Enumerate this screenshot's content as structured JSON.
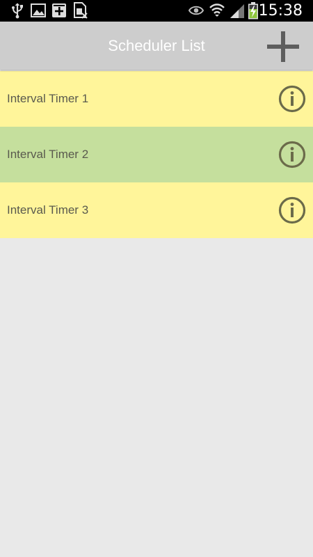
{
  "status_bar": {
    "time": "15:38",
    "icons": [
      "usb-icon",
      "image-icon",
      "calendar-plus-icon",
      "sim-card-icon",
      "eye-icon",
      "wifi-icon",
      "signal-icon",
      "battery-charging-icon"
    ]
  },
  "action_bar": {
    "title": "Scheduler List",
    "add_icon": "plus-icon"
  },
  "list": {
    "items": [
      {
        "label": "Interval Timer 1",
        "color": "#fff59a",
        "icon": "info-icon"
      },
      {
        "label": "Interval Timer 2",
        "color": "#c5df9d",
        "icon": "info-icon"
      },
      {
        "label": "Interval Timer 3",
        "color": "#fff59a",
        "icon": "info-icon"
      }
    ]
  },
  "colors": {
    "status_bar": "#000000",
    "action_bar": "#cdcdcd",
    "background": "#e9e9e9",
    "icon_gray": "#5e5e5e",
    "info_icon": "#6b6b4a"
  }
}
